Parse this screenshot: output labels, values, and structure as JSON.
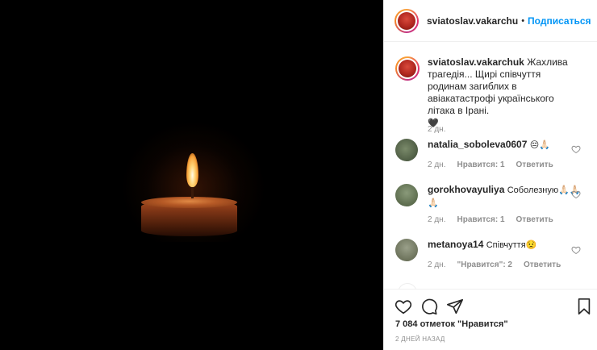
{
  "header": {
    "username": "sviatoslav.vakarchu",
    "separator": "•",
    "follow_label": "Подписаться"
  },
  "caption": {
    "username": "sviatoslav.vakarchuk",
    "text": "Жахлива трагедія... Щирі співчуття родинам загиблих в авіакатастрофі українського літака в Ірані.",
    "emoji": "🖤",
    "time": "2 дн."
  },
  "comments": [
    {
      "username": "natalia_soboleva0607",
      "text": "😔🙏🏻",
      "time": "2 дн.",
      "likes_label": "Нравится: 1",
      "reply_label": "Ответить"
    },
    {
      "username": "gorokhovayuliya",
      "text": "Соболезную🙏🏻🙏🏻🙏🏻",
      "time": "2 дн.",
      "likes_label": "Нравится: 1",
      "reply_label": "Ответить"
    },
    {
      "username": "metanoya14",
      "text": "Співчуття😟",
      "time": "2 дн.",
      "likes_label": "\"Нравится\": 2",
      "reply_label": "Ответить"
    }
  ],
  "footer": {
    "likes_text": "7 084 отметок \"Нравится\"",
    "date_text": "2 ДНЕЙ НАЗАД"
  },
  "icons": {
    "like": "heart-icon",
    "comment": "comment-icon",
    "share": "share-icon",
    "save": "bookmark-icon"
  },
  "colors": {
    "accent": "#0095f6",
    "muted": "#8e8e8e",
    "text": "#262626"
  }
}
